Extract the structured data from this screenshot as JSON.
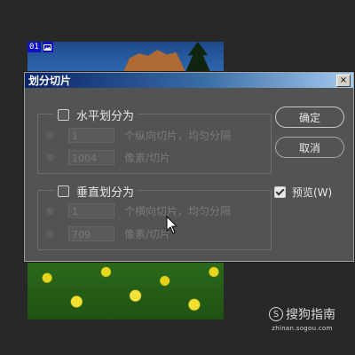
{
  "document": {
    "slice_number": "01"
  },
  "dialog": {
    "title": "划分切片",
    "close_glyph": "×",
    "horizontal": {
      "title": "水平划分为",
      "checked": false,
      "count_value": "1",
      "count_label": "个纵向切片，均匀分隔",
      "pixels_value": "1004",
      "pixels_label": "像素/切片"
    },
    "vertical": {
      "title": "垂直划分为",
      "checked": false,
      "count_value": "1",
      "count_label": "个横向切片，均匀分隔",
      "pixels_value": "709",
      "pixels_label": "像素/切片"
    },
    "ok_label": "确定",
    "cancel_label": "取消",
    "preview_label": "预览(W)",
    "preview_checked": true
  },
  "watermark": {
    "brand": "搜狗指南",
    "url": "zhinan.sogou.com"
  },
  "colors": {
    "dialog_bg": "#535353",
    "titlebar_start": "#0a246a",
    "titlebar_end": "#a6caf0",
    "canvas_bg": "#282828",
    "slice_badge": "#1010c8"
  }
}
